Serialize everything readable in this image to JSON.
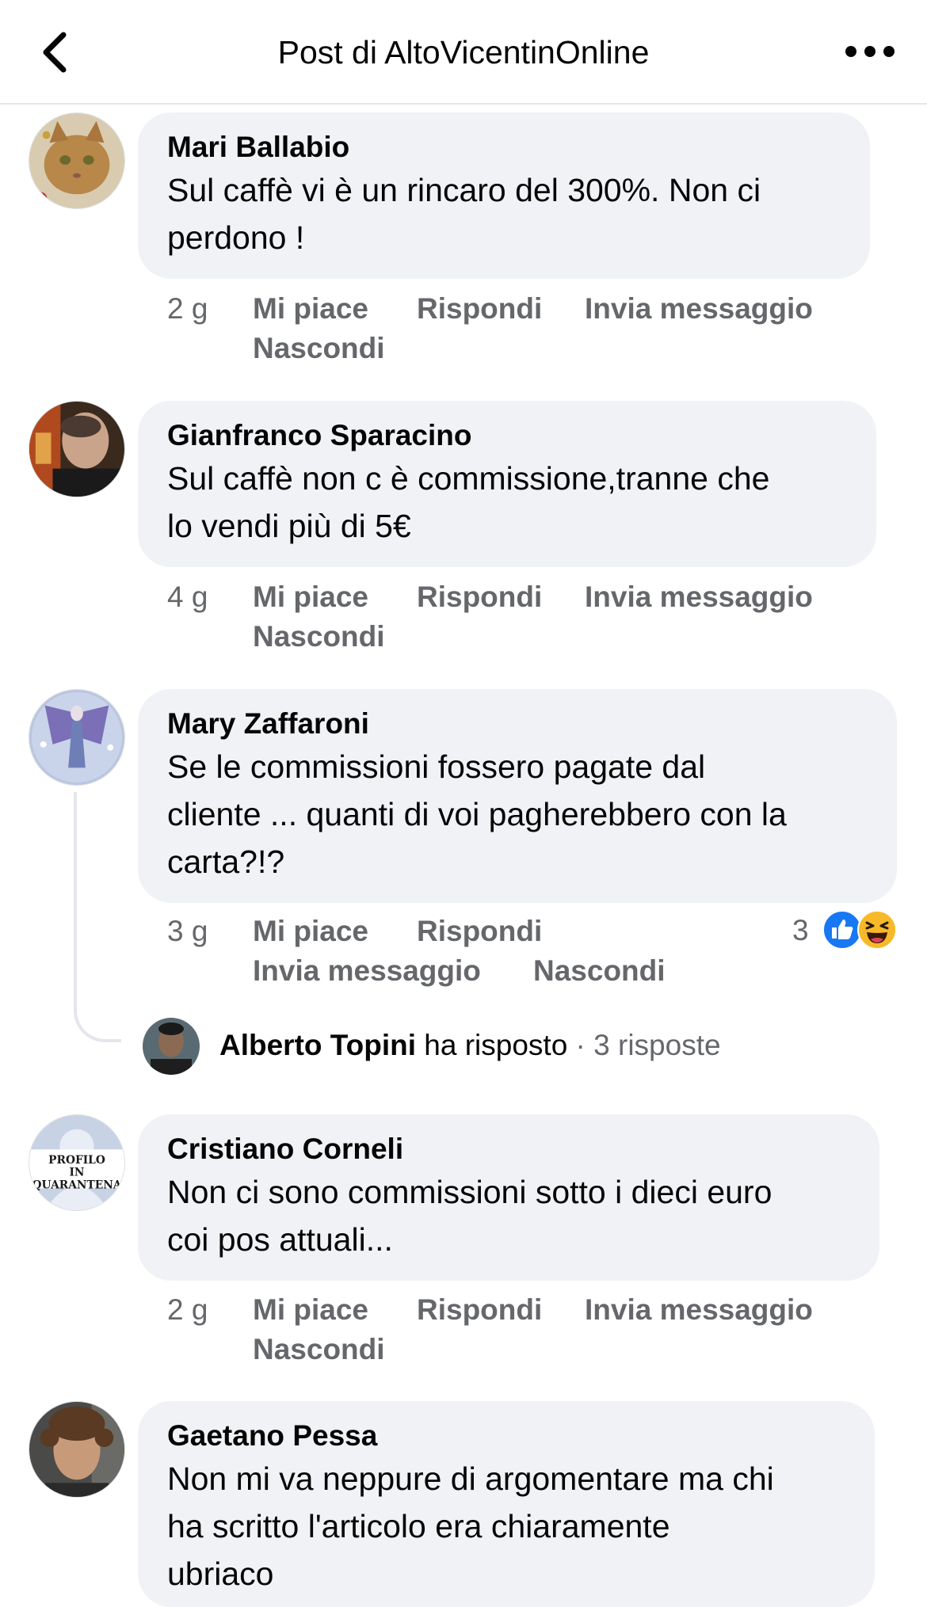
{
  "header": {
    "title": "Post di AltoVicentinOnline"
  },
  "comments": [
    {
      "name": "Mari Ballabio",
      "text_lines": [
        "Sul caffè vi è un rincaro del 300%. Non ci",
        "perdono !"
      ],
      "time": "2 g",
      "like": "Mi piace",
      "reply": "Rispondi",
      "message": "Invia messaggio",
      "hide": "Nascondi"
    },
    {
      "name": "Gianfranco Sparacino",
      "text_lines": [
        "Sul caffè non c è commissione,tranne che",
        "lo vendi più di 5€"
      ],
      "time": "4 g",
      "like": "Mi piace",
      "reply": "Rispondi",
      "message": "Invia messaggio",
      "hide": "Nascondi"
    },
    {
      "name": "Mary Zaffaroni",
      "text_lines": [
        "Se le commissioni fossero pagate dal",
        "cliente ... quanti di voi pagherebbero con la",
        "carta?!?"
      ],
      "time": "3 g",
      "like": "Mi piace",
      "reply": "Rispondi",
      "message": "Invia messaggio",
      "hide": "Nascondi",
      "reaction_count": "3",
      "reply_thread": {
        "name": "Alberto Topini",
        "action": " ha risposto",
        "count": " · 3 risposte"
      }
    },
    {
      "name": "Cristiano Corneli",
      "avatar_text": [
        "PROFILO",
        "IN",
        "QUARANTENA"
      ],
      "text_lines": [
        "Non ci sono commissioni sotto i dieci euro",
        "coi pos attuali..."
      ],
      "time": "2 g",
      "like": "Mi piace",
      "reply": "Rispondi",
      "message": "Invia messaggio",
      "hide": "Nascondi"
    },
    {
      "name": "Gaetano Pessa",
      "text_lines": [
        "Non mi va neppure di argomentare ma chi",
        "ha scritto l'articolo era chiaramente",
        "ubriaco"
      ]
    }
  ],
  "colors": {
    "bubble": "#f0f2f5",
    "meta": "#65676b",
    "like_blue": "#1877f2",
    "haha_yellow": "#f7b928"
  },
  "icons": {
    "back": "chevron-left-icon",
    "more": "more-dots-icon",
    "like": "like-reaction-icon",
    "haha": "haha-reaction-icon"
  }
}
